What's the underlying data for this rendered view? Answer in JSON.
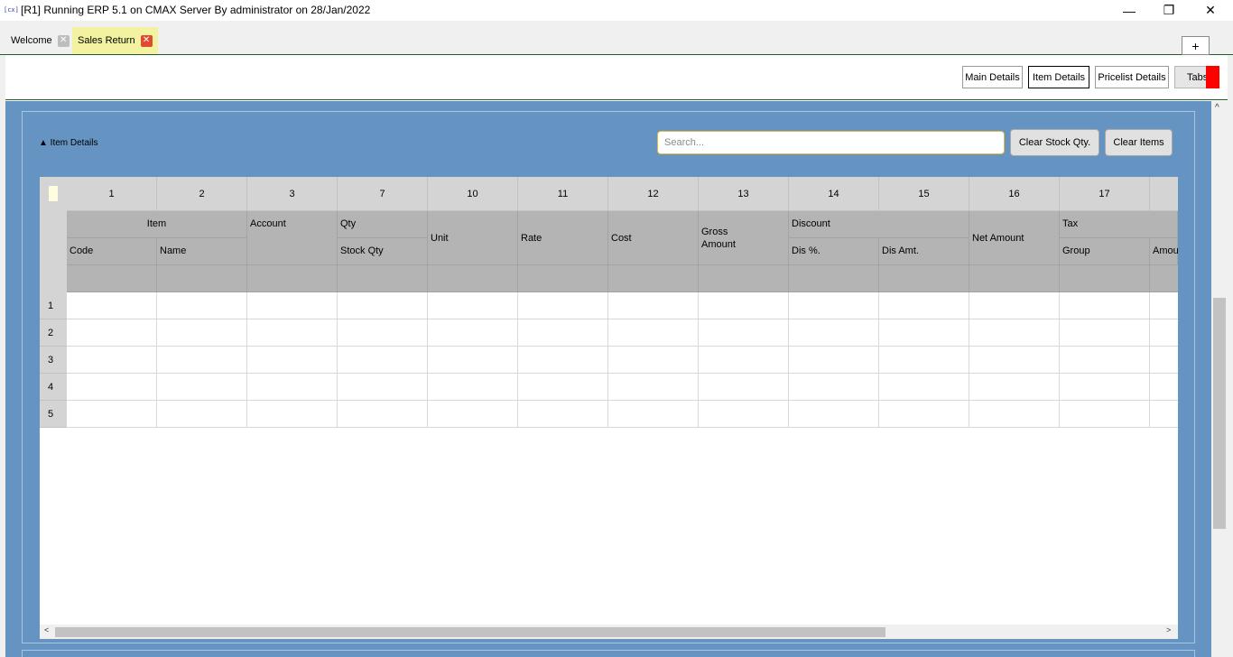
{
  "window": {
    "icon_text": "[cx]",
    "title": "[R1] Running ERP 5.1 on CMAX Server By administrator on 28/Jan/2022",
    "minimize": "—",
    "maximize": "❐",
    "close": "✕"
  },
  "tabs": [
    {
      "label": "Welcome",
      "close": "✕"
    },
    {
      "label": "Sales Return",
      "close": "✕"
    }
  ],
  "add_tab": "+",
  "nav": {
    "main_details": "Main Details",
    "item_details": "Item Details",
    "pricelist_details": "Pricelist Details",
    "tabs": "Tabs"
  },
  "section": {
    "title": "▲ Item Details",
    "search_placeholder": "Search...",
    "clear_stock_qty": "Clear Stock Qty.",
    "clear_items": "Clear Items"
  },
  "grid": {
    "column_numbers": [
      "1",
      "2",
      "3",
      "7",
      "10",
      "11",
      "12",
      "13",
      "14",
      "15",
      "16",
      "17",
      ""
    ],
    "headers": {
      "item": "Item",
      "code": "Code",
      "name": "Name",
      "account": "Account",
      "qty": "Qty",
      "stock_qty": "Stock Qty",
      "unit": "Unit",
      "rate": "Rate",
      "cost": "Cost",
      "gross_amount": "Gross Amount",
      "discount": "Discount",
      "dis_pct": "Dis %.",
      "dis_amt": "Dis Amt.",
      "net_amount": "Net Amount",
      "tax": "Tax",
      "group": "Group",
      "amount": "Amou"
    },
    "row_numbers": [
      "1",
      "2",
      "3",
      "4",
      "5"
    ]
  },
  "scroll": {
    "left": "<",
    "right": ">",
    "up": "^"
  }
}
